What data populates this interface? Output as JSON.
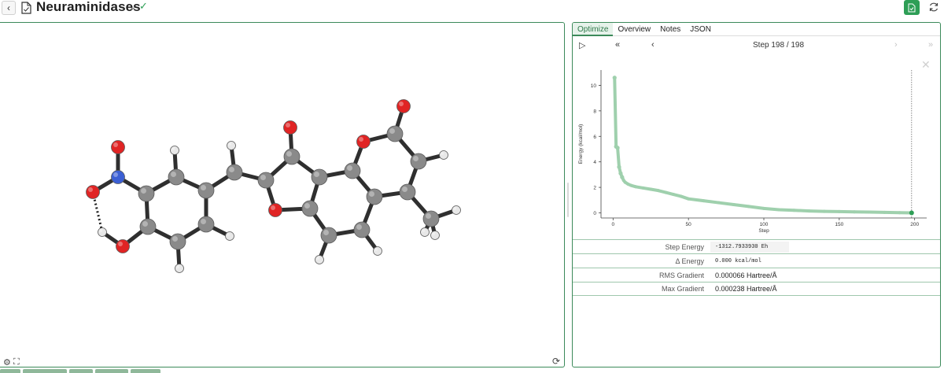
{
  "header": {
    "back_label": "‹",
    "title": "Neuraminidases",
    "chevron": "⌄",
    "check": "✓",
    "save_icon": "file-check-icon",
    "refresh_icon": "refresh-icon"
  },
  "viewer": {
    "settings_glyph": "⚙",
    "expand_glyph": "⛶",
    "refresh_glyph": "⟳"
  },
  "panel": {
    "tabs": [
      {
        "label": "Optimize",
        "active": true
      },
      {
        "label": "Overview",
        "active": false
      },
      {
        "label": "Notes",
        "active": false
      },
      {
        "label": "JSON",
        "active": false
      }
    ],
    "nav": {
      "play": "▷",
      "first": "«",
      "prev": "‹",
      "next": "›",
      "last": "»",
      "step_label": "Step 198 / 198"
    },
    "close_glyph": "✕",
    "properties": [
      {
        "label": "Step Energy",
        "value": "-1312.7933930 Eh",
        "mono": true,
        "shade": true
      },
      {
        "label": "Δ Energy",
        "value": "0.000 kcal/mol",
        "mono": true,
        "shade": false
      },
      {
        "label": "RMS Gradient",
        "value": "0.000066 Hartree/Å",
        "mono": false,
        "shade": false
      },
      {
        "label": "Max Gradient",
        "value": "0.000238 Hartree/Å",
        "mono": false,
        "shade": false
      }
    ]
  },
  "colors": {
    "accent": "#2e9e56",
    "series": "#9fd0ad",
    "current_point": "#2e9e56",
    "carbon": "#8a8a8a",
    "oxygen": "#e02424",
    "nitrogen": "#3b5fd4",
    "hydrogen": "#e8e8e8"
  },
  "chart_data": {
    "type": "line",
    "xlabel": "Step",
    "ylabel": "Energy (kcal/mol)",
    "xlim": [
      -8,
      208
    ],
    "ylim": [
      -0.4,
      11.2
    ],
    "xticks": [
      0,
      50,
      100,
      150,
      200
    ],
    "yticks": [
      0,
      2,
      4,
      6,
      8,
      10
    ],
    "current_step": 198,
    "series": [
      {
        "x": [
          1,
          2,
          3,
          4,
          5,
          6,
          7,
          8,
          10,
          12,
          15,
          20,
          25,
          30,
          35,
          40,
          45,
          50,
          60,
          70,
          80,
          90,
          100,
          110,
          120,
          130,
          140,
          150,
          160,
          170,
          180,
          190,
          198
        ],
        "values": [
          10.6,
          5.2,
          5.1,
          3.6,
          3.1,
          2.8,
          2.55,
          2.4,
          2.25,
          2.15,
          2.05,
          1.95,
          1.85,
          1.75,
          1.6,
          1.45,
          1.3,
          1.1,
          0.95,
          0.8,
          0.65,
          0.5,
          0.35,
          0.25,
          0.2,
          0.15,
          0.12,
          0.1,
          0.08,
          0.06,
          0.04,
          0.02,
          0.0
        ]
      }
    ]
  }
}
